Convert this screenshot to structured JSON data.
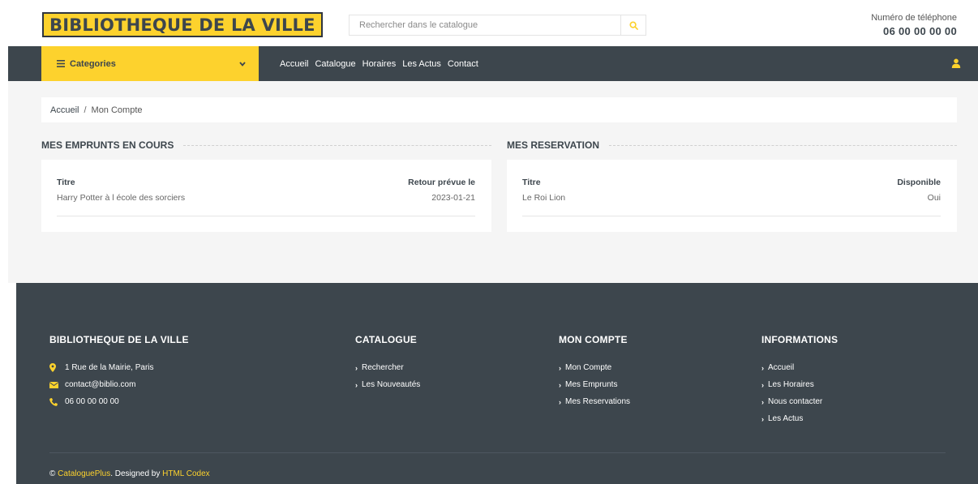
{
  "header": {
    "logo_text": "BIBLIOTHEQUE DE LA VILLE",
    "search": {
      "placeholder": "Rechercher dans le catalogue",
      "icon": "search-icon"
    },
    "phone_label": "Numéro de téléphone",
    "phone_number": "06 00 00 00 00"
  },
  "nav": {
    "categories_label": "Categories",
    "links": [
      "Accueil",
      "Catalogue",
      "Horaires",
      "Les Actus",
      "Contact"
    ],
    "user_icon": "user-icon"
  },
  "breadcrumb": {
    "home": "Accueil",
    "separator": "/",
    "current": "Mon Compte"
  },
  "loans": {
    "title": "MES EMPRUNTS EN COURS",
    "columns": [
      "Titre",
      "Retour prévue le"
    ],
    "rows": [
      [
        "Harry Potter à l école des sorciers",
        "2023-01-21"
      ]
    ]
  },
  "reservations": {
    "title": "MES RESERVATION",
    "columns": [
      "Titre",
      "Disponible"
    ],
    "rows": [
      [
        "Le Roi Lion",
        "Oui"
      ]
    ]
  },
  "footer": {
    "col1": {
      "title": "BIBLIOTHEQUE DE LA VILLE",
      "items": [
        {
          "icon": "map-marker-icon",
          "text": "1 Rue de la Mairie, Paris"
        },
        {
          "icon": "envelope-icon",
          "text": "contact@biblio.com"
        },
        {
          "icon": "phone-icon",
          "text": "06 00 00 00 00"
        }
      ]
    },
    "col2": {
      "title": "CATALOGUE",
      "items": [
        "Rechercher",
        "Les Nouveautés"
      ]
    },
    "col3": {
      "title": "MON COMPTE",
      "items": [
        "Mon Compte",
        "Mes Emprunts",
        "Mes Reservations"
      ]
    },
    "col4": {
      "title": "INFORMATIONS",
      "items": [
        "Accueil",
        "Les Horaires",
        "Nous contacter",
        "Les Actus"
      ]
    },
    "copyright_symbol": "©",
    "brand": "CataloguePlus",
    "designed_by": ". Designed by",
    "designer": "HTML Codex"
  },
  "colors": {
    "accent": "#fdd22d",
    "dark": "#3d464d",
    "content_bg": "#f5f5f5"
  }
}
